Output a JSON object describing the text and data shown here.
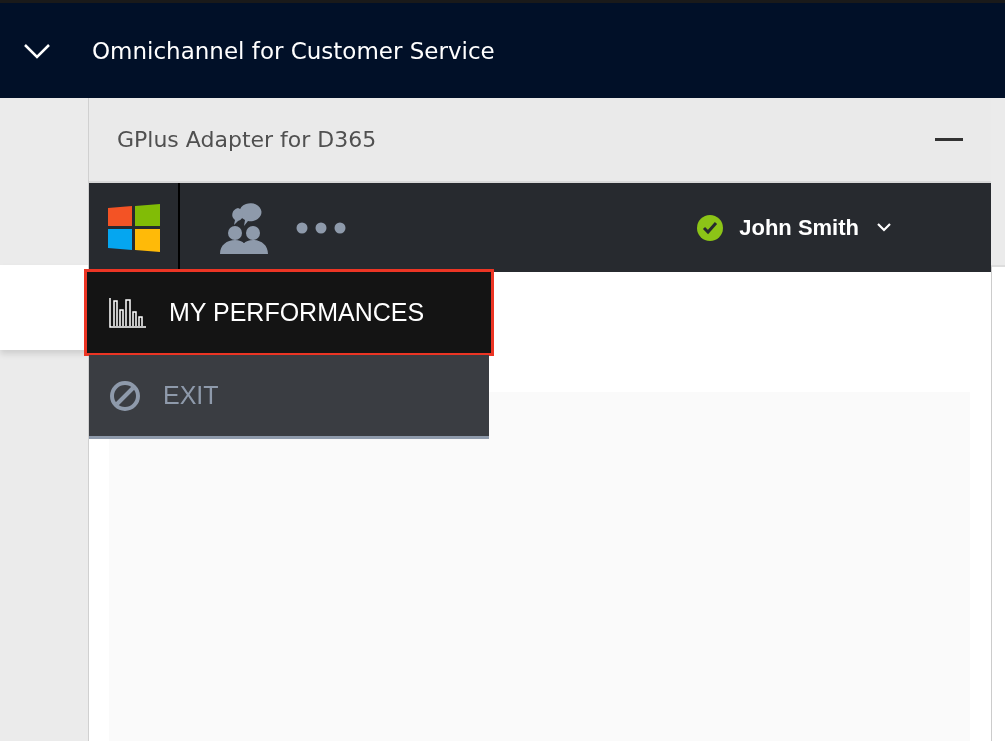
{
  "app_bar": {
    "title": "Omnichannel for Customer Service"
  },
  "panel": {
    "title": "GPlus Adapter for D365"
  },
  "toolbar": {
    "user": {
      "name": "John Smith",
      "online": true
    }
  },
  "menu": [
    {
      "label": "MY PERFORMANCES",
      "kind": "performance",
      "selected": true
    },
    {
      "label": "EXIT",
      "kind": "exit",
      "selected": false
    }
  ]
}
